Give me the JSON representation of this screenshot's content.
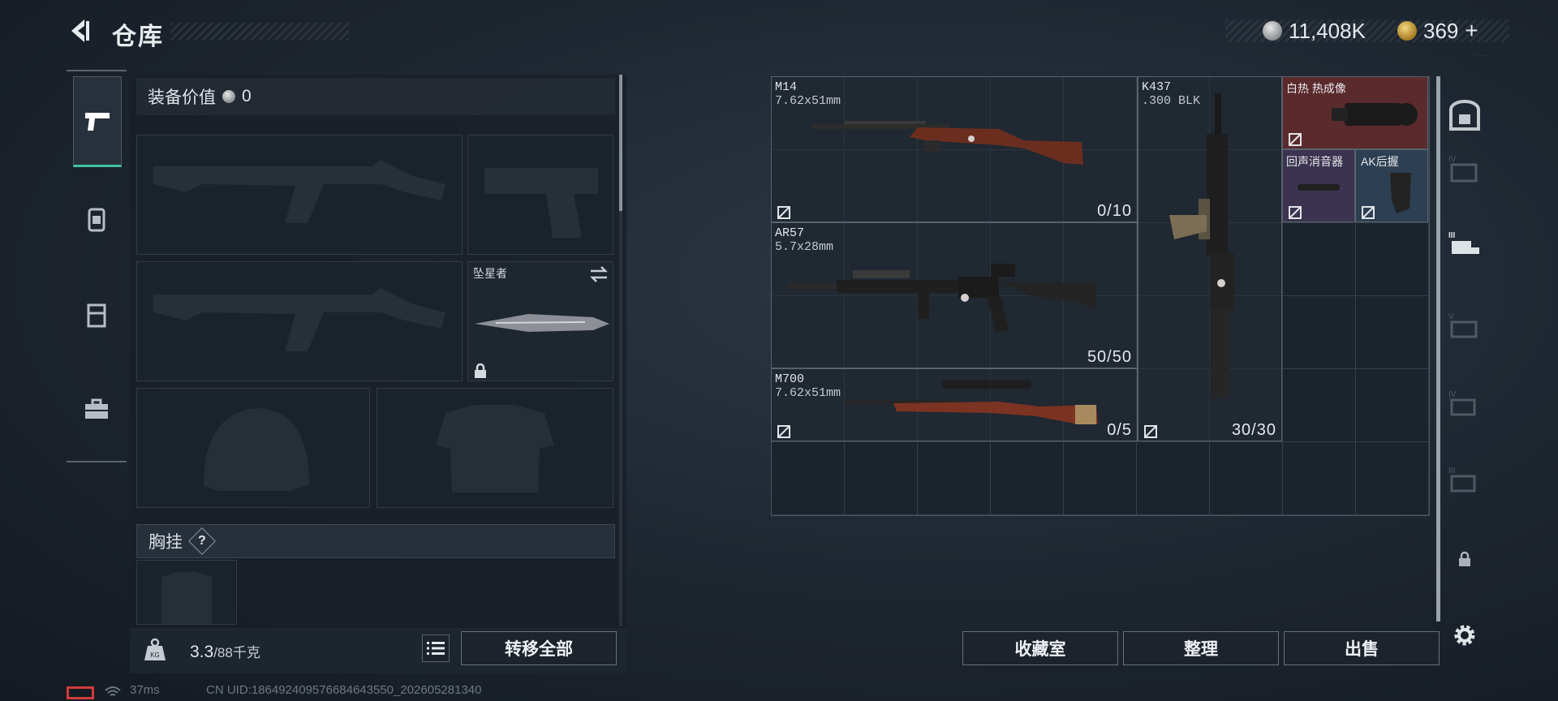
{
  "header": {
    "title": "仓库",
    "currency_silver": "11,408K",
    "currency_gold": "369",
    "currency_plus": "+"
  },
  "equipment": {
    "value_label": "装备价值",
    "value_amount": "0",
    "melee_name": "坠星者",
    "chest_label": "胸挂",
    "chest_help": "?"
  },
  "footer_left": {
    "weight_current": "3.3",
    "weight_max": "/88千克",
    "transfer_all_label": "转移全部"
  },
  "stash": {
    "items": [
      {
        "name": "M14",
        "caliber": "7.62x51mm",
        "ammo": "0/10"
      },
      {
        "name": "K437",
        "caliber": ".300 BLK",
        "ammo": "30/30"
      },
      {
        "name": "AR57",
        "caliber": "5.7x28mm",
        "ammo": "50/50"
      },
      {
        "name": "M700",
        "caliber": "7.62x51mm",
        "ammo": "0/5"
      },
      {
        "name": "白热 热成像"
      },
      {
        "name": "回声消音器"
      },
      {
        "name": "AK后握"
      }
    ]
  },
  "footer_right": {
    "collection_label": "收藏室",
    "organize_label": "整理",
    "sell_label": "出售"
  },
  "status": {
    "ping": "37ms",
    "uid": "CN UID:186492409576684643550_202605281340"
  },
  "icons": [
    "back-icon",
    "pistol-icon",
    "backpack-icon",
    "vest-icon",
    "toolbox-icon",
    "lock-icon",
    "swap-icon",
    "settings-icon",
    "list-icon",
    "weight-icon",
    "wifi-icon"
  ]
}
